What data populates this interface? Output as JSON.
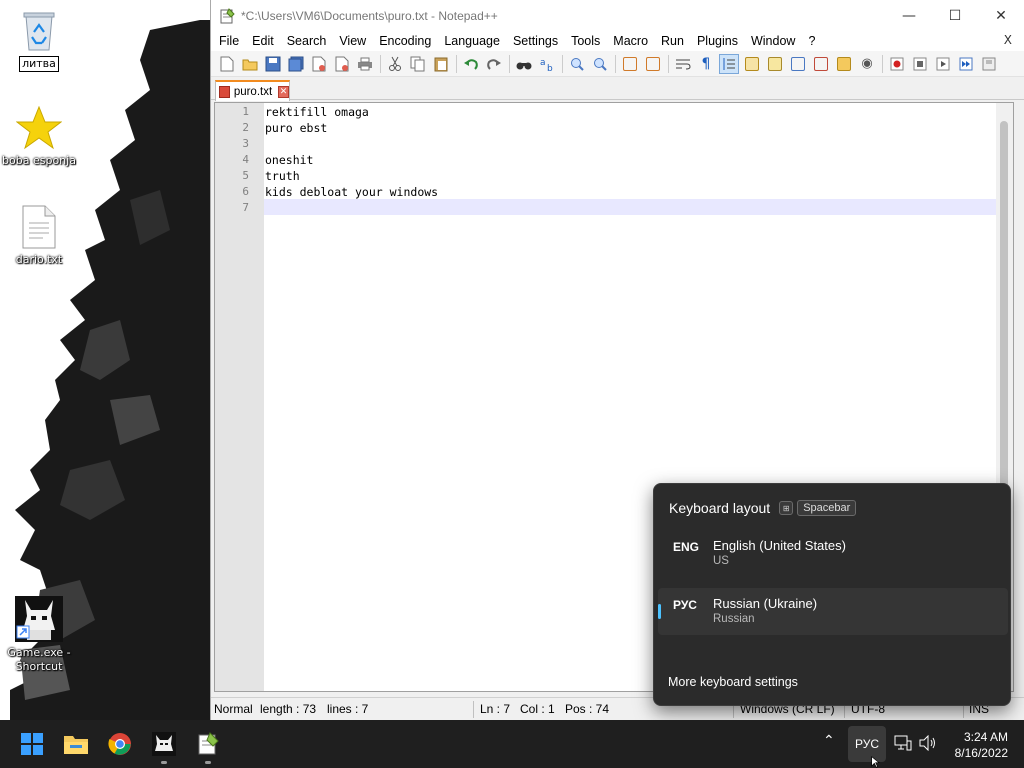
{
  "desktop": {
    "icons": [
      {
        "label": "литва",
        "kind": "recycle-bin",
        "renaming": true
      },
      {
        "label": "boba esponja",
        "kind": "star"
      },
      {
        "label": "dario.txt",
        "kind": "text-file"
      },
      {
        "label": "Game.exe - Shortcut",
        "kind": "game-shortcut"
      }
    ]
  },
  "notepad": {
    "title": "*C:\\Users\\VM6\\Documents\\puro.txt - Notepad++",
    "menu": [
      "File",
      "Edit",
      "Search",
      "View",
      "Encoding",
      "Language",
      "Settings",
      "Tools",
      "Macro",
      "Run",
      "Plugins",
      "Window",
      "?"
    ],
    "menu_close": "X",
    "tab": {
      "label": "puro.txt"
    },
    "lines": [
      {
        "num": "1",
        "text": "rektifill omaga"
      },
      {
        "num": "2",
        "text": "puro ebst"
      },
      {
        "num": "3",
        "text": ""
      },
      {
        "num": "4",
        "text": "oneshit"
      },
      {
        "num": "5",
        "text": "truth"
      },
      {
        "num": "6",
        "text": "kids debloat your windows"
      },
      {
        "num": "7",
        "text": ""
      }
    ],
    "status": {
      "mode": "Normal",
      "length": "length : 73",
      "lines": "lines : 7",
      "ln": "Ln : 7",
      "col": "Col : 1",
      "pos": "Pos : 74",
      "eol": "Windows (CR LF)",
      "encoding": "UTF-8",
      "ins": "INS"
    }
  },
  "flyout": {
    "title": "Keyboard layout",
    "shortcut_key": "Spacebar",
    "options": [
      {
        "code": "ENG",
        "name": "English (United States)",
        "sub": "US",
        "selected": false
      },
      {
        "code": "РУС",
        "name": "Russian (Ukraine)",
        "sub": "Russian",
        "selected": true
      }
    ],
    "more": "More keyboard settings"
  },
  "taskbar": {
    "lang": "РУС",
    "time": "3:24 AM",
    "date": "8/16/2022"
  },
  "colors": {
    "accent": "#4cc2ff",
    "taskbar": "#1f1f1f",
    "flyout_bg": "#2b2b2b",
    "tab_accent": "#f28b1f",
    "current_line": "#e8e8ff"
  }
}
